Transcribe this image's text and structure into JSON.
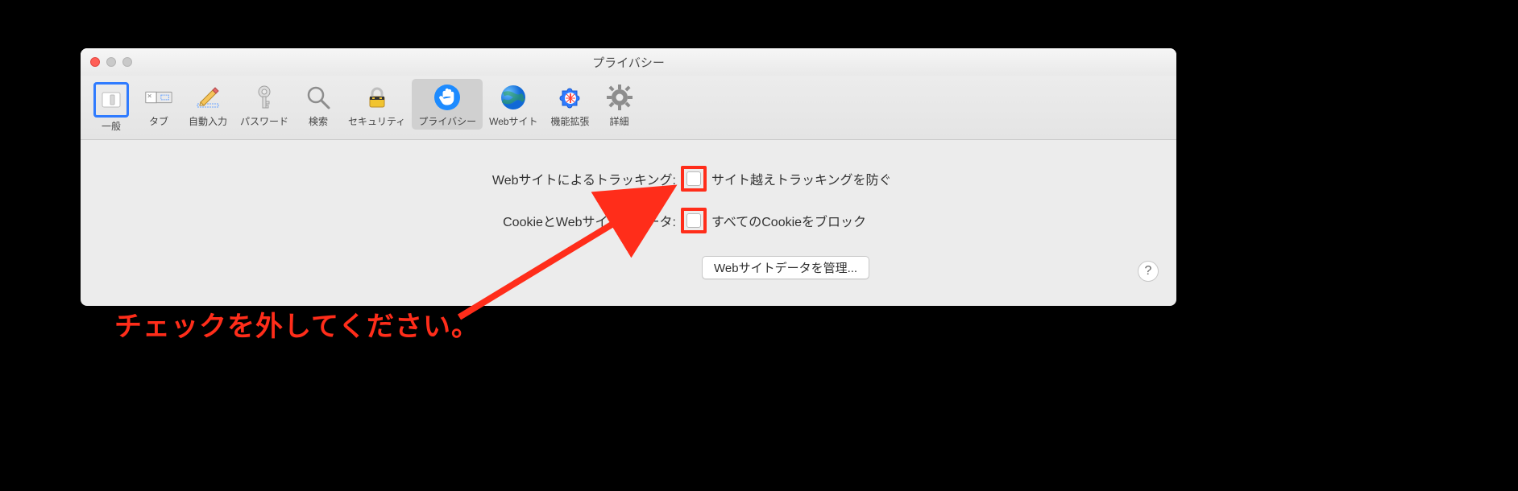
{
  "window": {
    "title": "プライバシー"
  },
  "toolbar": {
    "items": [
      {
        "label": "一般"
      },
      {
        "label": "タブ"
      },
      {
        "label": "自動入力"
      },
      {
        "label": "パスワード"
      },
      {
        "label": "検索"
      },
      {
        "label": "セキュリティ"
      },
      {
        "label": "プライバシー"
      },
      {
        "label": "Webサイト"
      },
      {
        "label": "機能拡張"
      },
      {
        "label": "詳細"
      }
    ]
  },
  "settings": {
    "tracking": {
      "label": "Webサイトによるトラッキング:",
      "option": "サイト越えトラッキングを防ぐ"
    },
    "cookies": {
      "label": "CookieとWebサイトのデータ:",
      "option": "すべてのCookieをブロック"
    },
    "manage_button": "Webサイトデータを管理..."
  },
  "annotation": {
    "text": "チェックを外してください。"
  },
  "help": {
    "glyph": "?"
  }
}
